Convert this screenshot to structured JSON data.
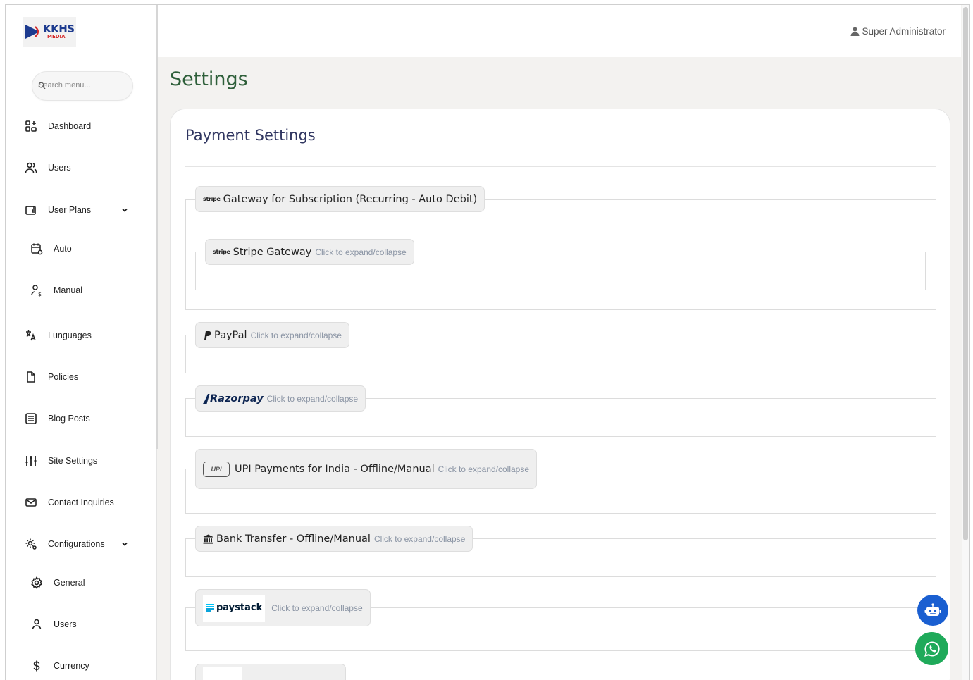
{
  "brand": {
    "logo_main": "KKHS",
    "logo_sub": "MEDIA"
  },
  "search": {
    "placeholder": "Search menu..."
  },
  "sidebar": {
    "items": [
      {
        "label": "Dashboard",
        "icon": "dashboard-icon"
      },
      {
        "label": "Users",
        "icon": "users-icon"
      },
      {
        "label": "User Plans",
        "icon": "wallet-icon"
      },
      {
        "label": "Auto",
        "icon": "calendar-refresh-icon"
      },
      {
        "label": "Manual",
        "icon": "user-dollar-icon"
      },
      {
        "label": "Lunguages",
        "icon": "translate-icon"
      },
      {
        "label": "Policies",
        "icon": "file-icon"
      },
      {
        "label": "Blog Posts",
        "icon": "list-doc-icon"
      },
      {
        "label": "Site Settings",
        "icon": "sliders-icon"
      },
      {
        "label": "Contact Inquiries",
        "icon": "mail-icon"
      },
      {
        "label": "Configurations",
        "icon": "settings-cog-icon"
      },
      {
        "label": "General",
        "icon": "gear-icon"
      },
      {
        "label": "Users",
        "icon": "user-icon"
      },
      {
        "label": "Currency",
        "icon": "dollar-icon"
      }
    ]
  },
  "header": {
    "user_name": "Super Administrator"
  },
  "page": {
    "title": "Settings"
  },
  "payment": {
    "title": "Payment Settings",
    "subscription_group": {
      "badge": "stripe",
      "label": "Gateway for Subscription (Recurring - Auto Debit)"
    },
    "gateways": [
      {
        "label": "Stripe Gateway",
        "badge": "stripe",
        "hint": "Click to expand/collapse"
      },
      {
        "label": "PayPal",
        "hint": "Click to expand/collapse"
      },
      {
        "label": "Razorpay",
        "hint": "Click to expand/collapse"
      },
      {
        "label": "UPI Payments for India - Offline/Manual",
        "badge": "UPI",
        "hint": "Click to expand/collapse"
      },
      {
        "label": "Bank Transfer - Offline/Manual",
        "hint": "Click to expand/collapse"
      },
      {
        "label": "paystack",
        "hint": "Click to expand/collapse"
      }
    ]
  },
  "colors": {
    "title_green": "#2e5f3a",
    "heading_navy": "#2f3560",
    "bot_blue": "#1a5fd1",
    "whatsapp_green": "#1faa5a",
    "brand_blue": "#1d3b8f",
    "brand_red": "#d42a2a"
  }
}
